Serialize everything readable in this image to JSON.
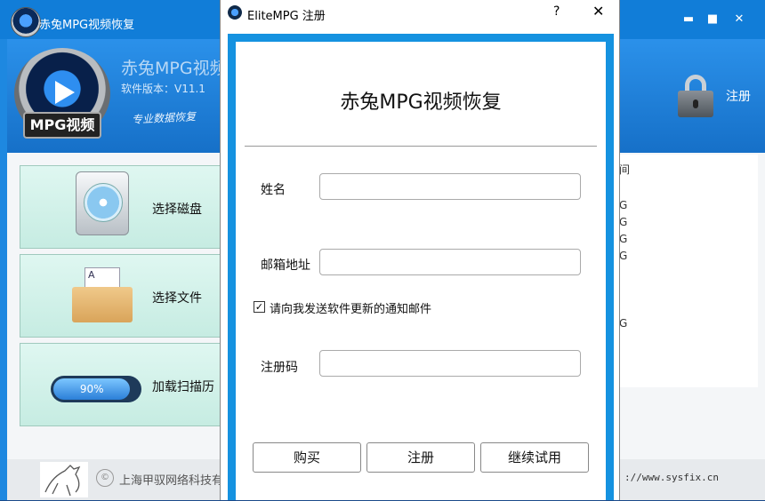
{
  "main_window": {
    "title": "赤兔MPG视频恢复",
    "controls": {
      "minimize": "▬",
      "maximize": "■",
      "close": "✕"
    }
  },
  "header": {
    "product_title": "赤兔MPG视频",
    "version": "软件版本：V11.1",
    "slogan": "专业数据恢复",
    "logo_badge": "MPG视频",
    "register_label": "注册",
    "lock_icon": "lock-icon"
  },
  "tiles": [
    {
      "label": "选择磁盘",
      "icon": "disk-icon"
    },
    {
      "label": "选择文件",
      "icon": "folder-icon"
    },
    {
      "label": "加载扫描历",
      "icon": "progress-icon",
      "progress_text": "90%",
      "progress": 0.9
    }
  ],
  "right_list": {
    "header": "间",
    "cells": [
      "G",
      "G",
      "G",
      "G",
      "G"
    ]
  },
  "footer": {
    "copyright_icon": "©",
    "company": "上海甲驭网络科技有",
    "url": "://www.sysfix.cn"
  },
  "dialog": {
    "title": "EliteMPG 注册",
    "help": "?",
    "close": "✕",
    "heading": "赤兔MPG视频恢复",
    "fields": {
      "name_label": "姓名",
      "name_value": "",
      "email_label": "邮箱地址",
      "email_value": "",
      "code_label": "注册码",
      "code_value": ""
    },
    "checkbox": {
      "checked": true,
      "mark": "✓",
      "label": "请向我发送软件更新的通知邮件"
    },
    "buttons": {
      "buy": "购买",
      "register": "注册",
      "trial": "继续试用"
    }
  }
}
